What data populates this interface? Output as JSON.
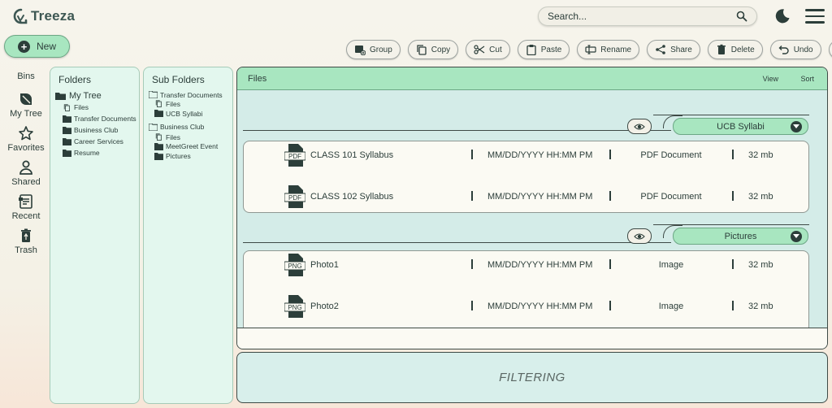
{
  "app": {
    "name": "Treeza"
  },
  "search": {
    "placeholder": "Search..."
  },
  "new_button": {
    "label": "New"
  },
  "toolbar": {
    "group": "Group",
    "copy": "Copy",
    "cut": "Cut",
    "paste": "Paste",
    "rename": "Rename",
    "share": "Share",
    "delete": "Delete",
    "undo": "Undo"
  },
  "nav": {
    "bins": "Bins",
    "items": [
      "My Tree",
      "Favorites",
      "Shared",
      "Recent",
      "Trash"
    ]
  },
  "folders": {
    "title": "Folders",
    "root": "My Tree",
    "children": [
      "Files",
      "Transfer Documents",
      "Business Club",
      "Career Services",
      "Resume"
    ]
  },
  "subfolders": {
    "title": "Sub Folders",
    "groups": [
      {
        "name": "Transfer Documents",
        "children": [
          "Files",
          "UCB Syllabi"
        ]
      },
      {
        "name": "Business Club",
        "children": [
          "Files",
          "MeetGreet Event",
          "Pictures"
        ]
      }
    ]
  },
  "main": {
    "title": "Files",
    "view": "View",
    "sort": "Sort",
    "groups": [
      {
        "label": "UCB Syllabi",
        "files": [
          {
            "icon": "PDF",
            "name": "CLASS 101 Syllabus",
            "date": "MM/DD/YYYY HH:MM PM",
            "type": "PDF Document",
            "size": "32 mb"
          },
          {
            "icon": "PDF",
            "name": "CLASS 102 Syllabus",
            "date": "MM/DD/YYYY HH:MM PM",
            "type": "PDF Document",
            "size": "32 mb"
          }
        ]
      },
      {
        "label": "Pictures",
        "files": [
          {
            "icon": "PNG",
            "name": "Photo1",
            "date": "MM/DD/YYYY HH:MM PM",
            "type": "Image",
            "size": "32 mb"
          },
          {
            "icon": "PNG",
            "name": "Photo2",
            "date": "MM/DD/YYYY HH:MM PM",
            "type": "Image",
            "size": "32 mb"
          }
        ]
      }
    ]
  },
  "filtering": {
    "label": "FILTERING"
  },
  "colors": {
    "accent": "#a8e6c0",
    "panel": "#e3f7ee",
    "main_bg": "#d4ece8",
    "text": "#2c3e3a"
  }
}
